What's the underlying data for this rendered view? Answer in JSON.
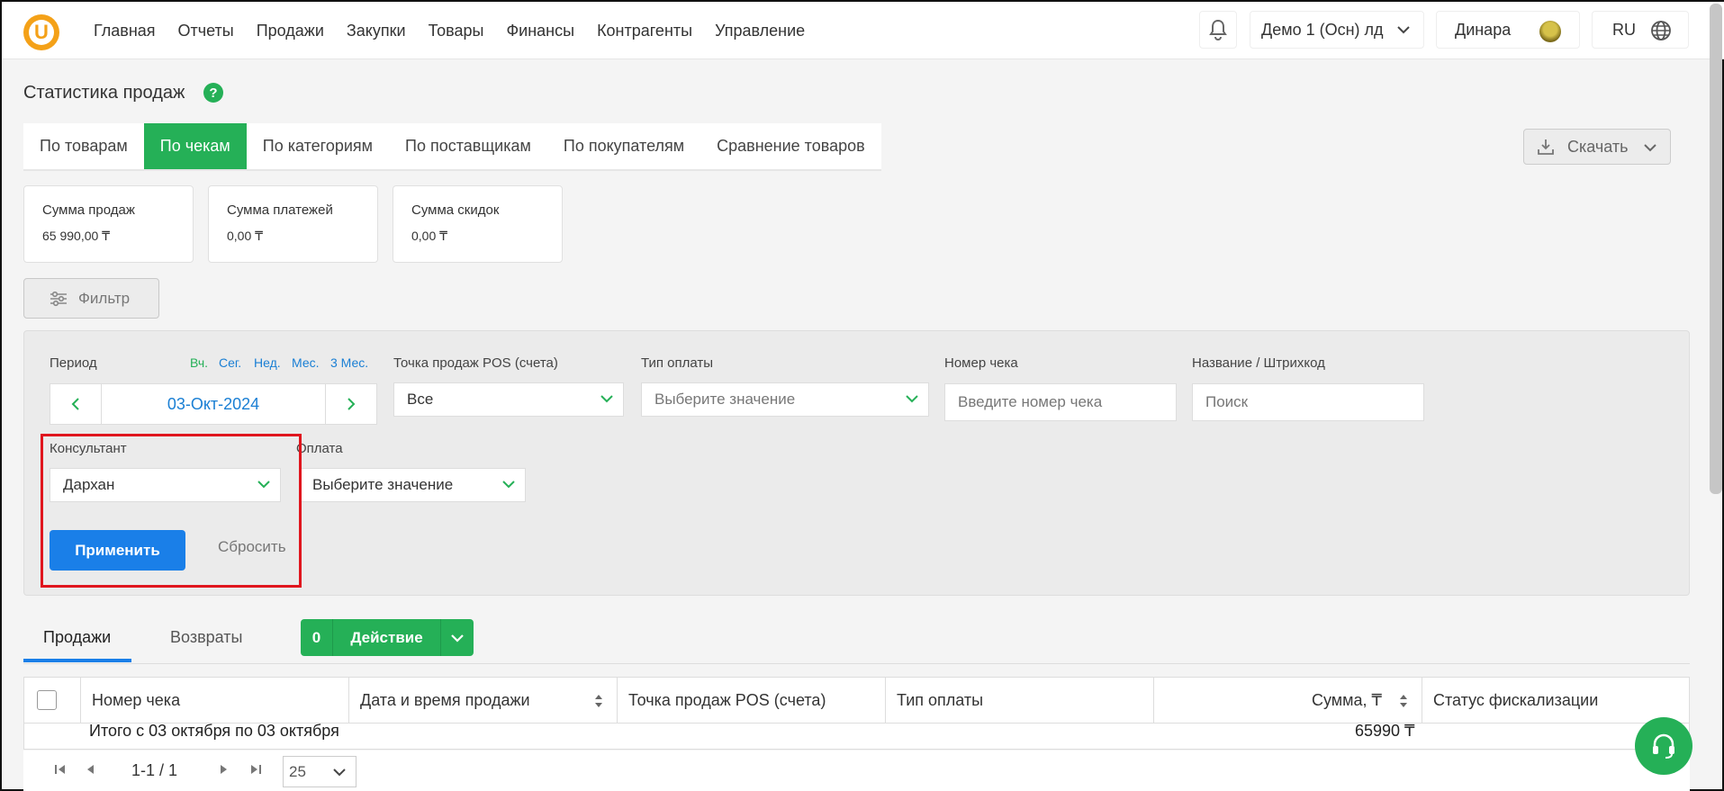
{
  "nav": {
    "items": [
      "Главная",
      "Отчеты",
      "Продажи",
      "Закупки",
      "Товары",
      "Финансы",
      "Контрагенты",
      "Управление"
    ],
    "logo_letter": "U",
    "store": "Демо 1 (Осн) лд",
    "user": "Динара",
    "lang": "RU"
  },
  "page": {
    "title": "Статистика продаж",
    "help": "?"
  },
  "tabs": [
    "По товарам",
    "По чекам",
    "По категориям",
    "По поставщикам",
    "По покупателям",
    "Сравнение товаров"
  ],
  "download_label": "Скачать",
  "cards": [
    {
      "label": "Сумма продаж",
      "value": "65 990,00 ₸"
    },
    {
      "label": "Сумма платежей",
      "value": "0,00 ₸"
    },
    {
      "label": "Сумма скидок",
      "value": "0,00 ₸"
    }
  ],
  "filter_button": "Фильтр",
  "filters": {
    "period_label": "Период",
    "quick": [
      "Вч.",
      "Сег.",
      "Нед.",
      "Мес.",
      "3 Мес."
    ],
    "date": "03-Окт-2024",
    "pos_label": "Точка продаж POS (счета)",
    "pos_value": "Все",
    "payment_type_label": "Тип оплаты",
    "payment_type_placeholder": "Выберите значение",
    "receipt_label": "Номер чека",
    "receipt_placeholder": "Введите номер чека",
    "name_label": "Название / Штрихкод",
    "name_placeholder": "Поиск",
    "consultant_label": "Консультант",
    "consultant_value": "Дархан",
    "payment_label": "Оплата",
    "payment_value": "Выберите значение",
    "apply": "Применить",
    "reset": "Сбросить"
  },
  "subtabs": [
    "Продажи",
    "Возвраты"
  ],
  "action": {
    "count": "0",
    "label": "Действие"
  },
  "table": {
    "headers": [
      "Номер чека",
      "Дата и время продажи",
      "Точка продаж POS (счета)",
      "Тип оплаты",
      "Сумма, ₸",
      "Статус фискализации"
    ],
    "total_label": "Итого с 03 октября по 03 октября",
    "total_value": "65990 ₸"
  },
  "pager": {
    "range": "1-1 / 1",
    "page_size": "25"
  }
}
